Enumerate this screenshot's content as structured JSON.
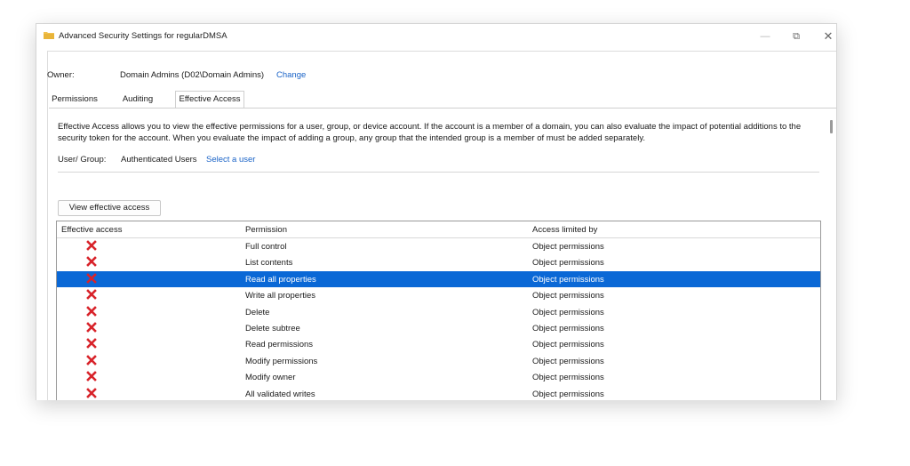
{
  "window": {
    "title": "Advanced Security Settings for regularDMSA"
  },
  "controls": {
    "minimize": "—",
    "restore": "⧉",
    "close": "✕"
  },
  "owner": {
    "label": "Owner:",
    "value": "Domain Admins (D02\\Domain Admins)",
    "change_link": "Change"
  },
  "tabs": [
    {
      "label": "Permissions",
      "active": false
    },
    {
      "label": "Auditing",
      "active": false
    },
    {
      "label": "Effective Access",
      "active": true
    }
  ],
  "description": "Effective Access allows you to view the effective permissions for a user, group, or device account. If the account is a member of a domain, you can also evaluate the impact of potential additions to the security token for the account. When you evaluate the impact of adding a group, any group that the intended group is a member of must be added separately.",
  "user_group": {
    "label": "User/ Group:",
    "value": "Authenticated Users",
    "select_link": "Select a user"
  },
  "view_button": "View effective access",
  "table": {
    "headers": [
      "Effective access",
      "Permission",
      "Access limited by"
    ],
    "rows": [
      {
        "access_icon": "red-x-icon",
        "permission": "Full control",
        "limited_by": "Object permissions",
        "selected": false
      },
      {
        "access_icon": "red-x-icon",
        "permission": "List contents",
        "limited_by": "Object permissions",
        "selected": false
      },
      {
        "access_icon": "red-x-icon",
        "permission": "Read all properties",
        "limited_by": "Object permissions",
        "selected": true
      },
      {
        "access_icon": "red-x-icon",
        "permission": "Write all properties",
        "limited_by": "Object permissions",
        "selected": false
      },
      {
        "access_icon": "red-x-icon",
        "permission": "Delete",
        "limited_by": "Object permissions",
        "selected": false
      },
      {
        "access_icon": "red-x-icon",
        "permission": "Delete subtree",
        "limited_by": "Object permissions",
        "selected": false
      },
      {
        "access_icon": "red-x-icon",
        "permission": "Read permissions",
        "limited_by": "Object permissions",
        "selected": false
      },
      {
        "access_icon": "red-x-icon",
        "permission": "Modify permissions",
        "limited_by": "Object permissions",
        "selected": false
      },
      {
        "access_icon": "red-x-icon",
        "permission": "Modify owner",
        "limited_by": "Object permissions",
        "selected": false
      },
      {
        "access_icon": "red-x-icon",
        "permission": "All validated writes",
        "limited_by": "Object permissions",
        "selected": false
      }
    ]
  },
  "colors": {
    "link": "#1a63c7",
    "selection": "#0a68d6",
    "deny": "#d8232a",
    "folder": "#f2c14e"
  }
}
